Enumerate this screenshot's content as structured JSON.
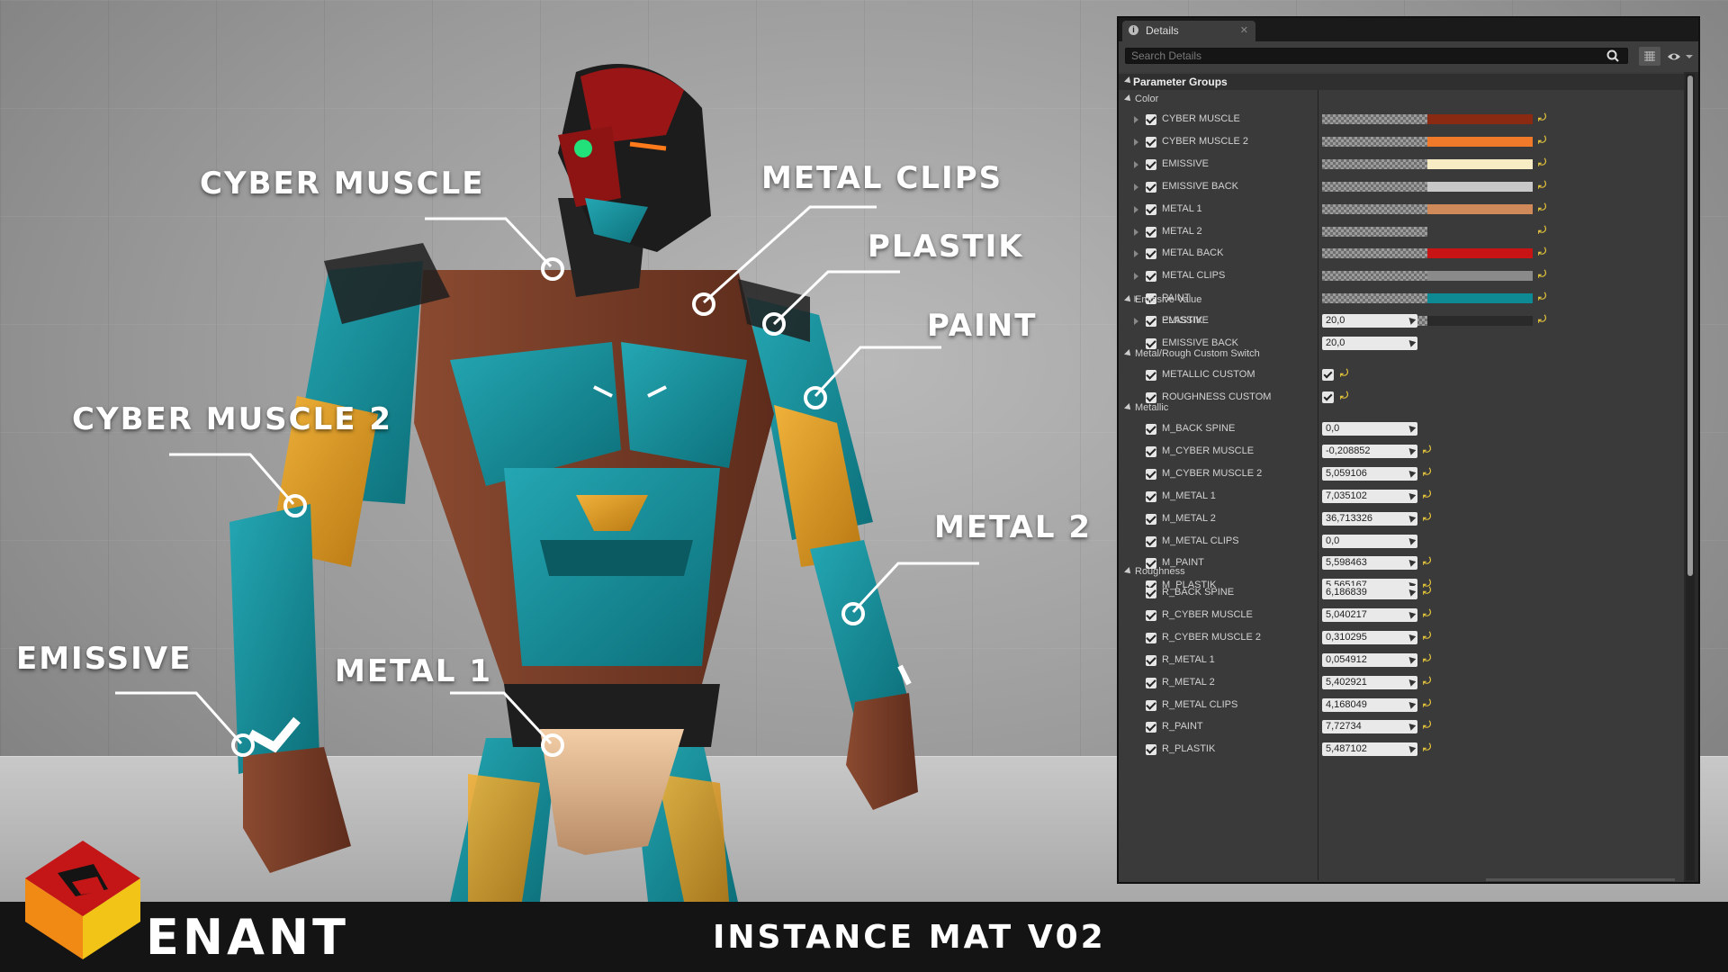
{
  "viewport": {
    "callouts": [
      {
        "label": "CYBER MUSCLE"
      },
      {
        "label": "METAL CLIPS"
      },
      {
        "label": "PLASTIK"
      },
      {
        "label": "PAINT"
      },
      {
        "label": "CYBER MUSCLE 2"
      },
      {
        "label": "METAL 2"
      },
      {
        "label": "EMISSIVE"
      },
      {
        "label": "METAL 1"
      }
    ]
  },
  "footer": {
    "brand": "ENANT",
    "title": "INSTANCE MAT V02"
  },
  "details_panel": {
    "tab_title": "Details",
    "tab_icon": "info-icon",
    "search_placeholder": "Search Details",
    "root_group": "Parameter Groups",
    "color_group": {
      "label": "Color",
      "params": [
        {
          "name": "CYBER MUSCLE",
          "color": "#8a2a12"
        },
        {
          "name": "CYBER MUSCLE 2",
          "color": "#f07a2a"
        },
        {
          "name": "EMISSIVE",
          "color": "#f8ecc4"
        },
        {
          "name": "EMISSIVE  BACK",
          "color": "#c8c8c8"
        },
        {
          "name": "METAL 1",
          "color": "#d08a5a"
        },
        {
          "name": "METAL 2",
          "color": "#3a3a3a"
        },
        {
          "name": "METAL BACK",
          "color": "#c81414"
        },
        {
          "name": "METAL CLIPS",
          "color": "#8a8a8a"
        },
        {
          "name": "PAINT",
          "color": "#0e8a94"
        },
        {
          "name": "PLASTIK",
          "color": "#2a2a2a"
        }
      ]
    },
    "emissive_group": {
      "label": "Emissive Value",
      "params": [
        {
          "name": "EMISSIVE",
          "value": "20,0"
        },
        {
          "name": "EMISSIVE BACK",
          "value": "20,0"
        }
      ]
    },
    "switch_group": {
      "label": "Metal/Rough Custom Switch",
      "params": [
        {
          "name": "METALLIC CUSTOM",
          "checked": true
        },
        {
          "name": "ROUGHNESS CUSTOM",
          "checked": true
        }
      ]
    },
    "metallic_group": {
      "label": "Metallic",
      "params": [
        {
          "name": "M_BACK SPINE",
          "value": "0,0",
          "reset": false
        },
        {
          "name": "M_CYBER MUSCLE",
          "value": "-0,208852",
          "reset": true
        },
        {
          "name": "M_CYBER MUSCLE 2",
          "value": "5,059106",
          "reset": true
        },
        {
          "name": "M_METAL 1",
          "value": "7,035102",
          "reset": true
        },
        {
          "name": "M_METAL 2",
          "value": "36,713326",
          "reset": true
        },
        {
          "name": "M_METAL CLIPS",
          "value": "0,0",
          "reset": false
        },
        {
          "name": "M_PAINT",
          "value": "5,598463",
          "reset": true
        },
        {
          "name": "M_PLASTIK",
          "value": "5,565167",
          "reset": true
        }
      ]
    },
    "roughness_group": {
      "label": "Roughness",
      "params": [
        {
          "name": "R_BACK SPINE",
          "value": "6,186839",
          "reset": true
        },
        {
          "name": "R_CYBER MUSCLE",
          "value": "5,040217",
          "reset": true
        },
        {
          "name": "R_CYBER MUSCLE 2",
          "value": "0,310295",
          "reset": true
        },
        {
          "name": "R_METAL 1",
          "value": "0,054912",
          "reset": true
        },
        {
          "name": "R_METAL 2",
          "value": "5,402921",
          "reset": true
        },
        {
          "name": "R_METAL CLIPS",
          "value": "4,168049",
          "reset": true
        },
        {
          "name": "R_PAINT",
          "value": "7,72734",
          "reset": true
        },
        {
          "name": "R_PLASTIK",
          "value": "5,487102",
          "reset": true
        }
      ]
    }
  }
}
